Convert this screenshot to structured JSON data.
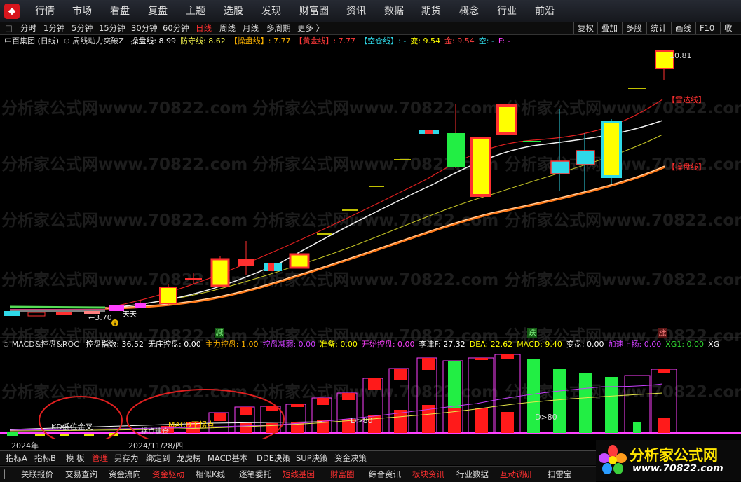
{
  "nav": {
    "logo": "⬥",
    "items": [
      "行情",
      "市场",
      "看盘",
      "复盘",
      "主题",
      "选股",
      "发现",
      "财富圈",
      "资讯",
      "数据",
      "期货",
      "概念",
      "行业",
      "前沿"
    ]
  },
  "periods": {
    "toggle": "□",
    "items": [
      "分时",
      "1分钟",
      "5分钟",
      "15分钟",
      "30分钟",
      "60分钟",
      "日线",
      "周线",
      "月线",
      "多周期",
      "更多 〉"
    ],
    "active": "日线"
  },
  "right_tools": [
    "复权",
    "叠加",
    "多股",
    "统计",
    "画线",
    "F10",
    "收"
  ],
  "main_info": {
    "stock": "中百集团 (日线)",
    "indicator": "周线动力突破Z",
    "segments": [
      {
        "text": "操盘线: 8.99",
        "color": "#ffffff"
      },
      {
        "text": "防守线: 8.62",
        "color": "#e8e84a"
      },
      {
        "text": "【操盘线】: 7.77",
        "color": "#ffb400"
      },
      {
        "text": "【黄金线】: 7.77",
        "color": "#ff3a3a"
      },
      {
        "text": "【空仓线】: -",
        "color": "#2fd9e8"
      },
      {
        "text": "变: 9.54",
        "color": "#ffff00"
      },
      {
        "text": "金: 9.54",
        "color": "#ff4040"
      },
      {
        "text": "空: -",
        "color": "#2fd9e8"
      },
      {
        "text": "F: -",
        "color": "#ff40ff"
      }
    ]
  },
  "price_labels": {
    "high": "10.81",
    "low": "←3.70",
    "radar": "【雷达线】",
    "caopan": "【操盘线】",
    "cross": "天天"
  },
  "signals": {
    "jian": "减",
    "die": "跌",
    "zhang": "涨"
  },
  "sub_info": {
    "title": "MACD&控盘&ROC",
    "segments": [
      {
        "text": "控盘指数: 36.52",
        "color": "#ffffff"
      },
      {
        "text": "无庄控盘: 0.00",
        "color": "#ffffff"
      },
      {
        "text": "主力控盘: 1.00",
        "color": "#ffb400"
      },
      {
        "text": "控盘减弱: 0.00",
        "color": "#d040ff"
      },
      {
        "text": "准备: 0.00",
        "color": "#ffff00"
      },
      {
        "text": "开始控盘: 0.00",
        "color": "#ff40ff"
      },
      {
        "text": "李津F: 27.32",
        "color": "#ffffff"
      },
      {
        "text": "DEA: 22.62",
        "color": "#ffff00"
      },
      {
        "text": "MACD: 9.40",
        "color": "#ffff00"
      },
      {
        "text": "变盘: 0.00",
        "color": "#ffffff"
      },
      {
        "text": "加速上扬: 0.00",
        "color": "#d040ff"
      },
      {
        "text": "XG1: 0.00",
        "color": "#33dd33"
      },
      {
        "text": "XG",
        "color": "#ffffff"
      }
    ]
  },
  "sub_labels": {
    "kd": "KD低位金叉",
    "macd": "MACD下拐点",
    "point": "拐点建仓",
    "d80a": "D>80",
    "d80b": "D>80"
  },
  "dates": {
    "year": "2024年",
    "date": "2024/11/28/四"
  },
  "bottom_tabs": [
    "指标A",
    "指标B",
    "模 板",
    "管理",
    "另存为",
    "绑定到",
    "龙虎榜",
    "MACD基本",
    "DDE决策",
    "SUP决策",
    "资金决策"
  ],
  "bottom_tabs_active": "管理",
  "bottom_links": [
    "关联报价",
    "交易查询",
    "资金流向",
    "资金驱动",
    "相似K线",
    "逐笔委托",
    "短线基因",
    "财富圈",
    "综合资讯",
    "板块资讯",
    "行业数据",
    "互动调研",
    "扫雷宝"
  ],
  "bottom_links_red": [
    "资金驱动",
    "短线基因",
    "财富圈",
    "板块资讯",
    "互动调研"
  ],
  "brand": {
    "title": "分析家公式网",
    "url": "www.70822.com"
  },
  "watermark": [
    "分析家公式网www.70822.com"
  ]
}
